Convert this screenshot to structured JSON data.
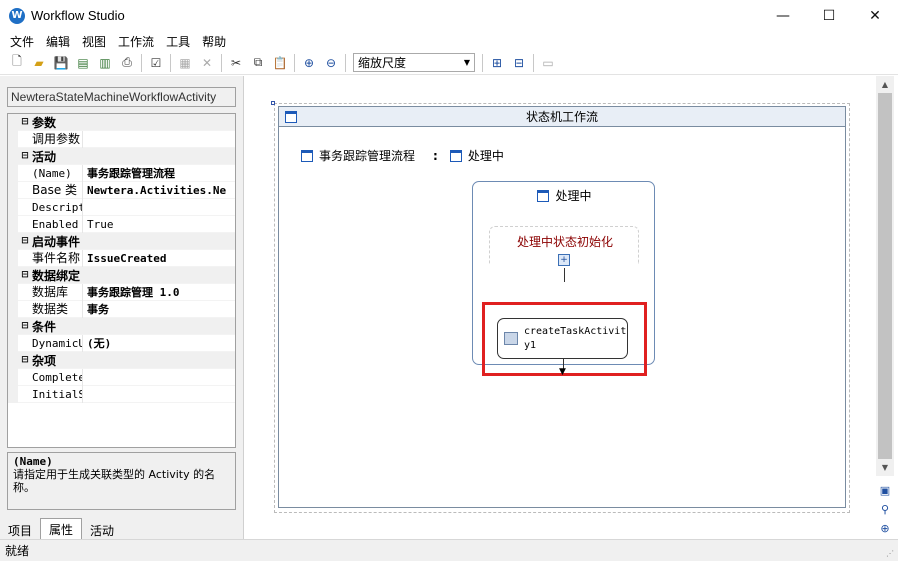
{
  "window": {
    "title": "Workflow Studio",
    "app_icon": "W",
    "minimize": "—",
    "maximize": "☐",
    "close": "✕"
  },
  "menu": [
    "文件",
    "编辑",
    "视图",
    "工作流",
    "工具",
    "帮助"
  ],
  "toolbar": {
    "zoom_label": "缩放尺度"
  },
  "properties": {
    "object_name": "NewteraStateMachineWorkflowActivity",
    "rows": [
      {
        "type": "cat",
        "label": "参数"
      },
      {
        "type": "prop",
        "name": "调用参数",
        "value": "",
        "lock": true
      },
      {
        "type": "cat",
        "label": "活动"
      },
      {
        "type": "prop",
        "name": "(Name)",
        "value": "事务跟踪管理流程",
        "bold": true
      },
      {
        "type": "prop",
        "name": "Base 类",
        "value": "Newtera.Activities.Ne",
        "bold": true
      },
      {
        "type": "prop",
        "name": "Descriptio",
        "value": ""
      },
      {
        "type": "prop",
        "name": "Enabled",
        "value": "True"
      },
      {
        "type": "cat",
        "label": "启动事件"
      },
      {
        "type": "prop",
        "name": "事件名称",
        "value": "IssueCreated",
        "bold": true
      },
      {
        "type": "cat",
        "label": "数据绑定"
      },
      {
        "type": "prop",
        "name": "数据库",
        "value": "事务跟踪管理 1.0",
        "bold": true
      },
      {
        "type": "prop",
        "name": "数据类",
        "value": "事务",
        "bold": true
      },
      {
        "type": "cat",
        "label": "条件"
      },
      {
        "type": "prop",
        "name": "DynamicUpd",
        "value": "(无)",
        "bold": true
      },
      {
        "type": "cat",
        "label": "杂项"
      },
      {
        "type": "prop",
        "name": "CompletedS",
        "value": ""
      },
      {
        "type": "prop",
        "name": "InitialSta",
        "value": ""
      }
    ],
    "description": {
      "title": "(Name)",
      "text": "请指定用于生成关联类型的 Activity 的名称。"
    },
    "tabs": [
      "项目",
      "属性",
      "活动"
    ]
  },
  "designer": {
    "state_machine_title": "状态机工作流",
    "link_workflow": "事务跟踪管理流程",
    "link_separator": ":",
    "link_state": "处理中",
    "state_title": "处理中",
    "init_title": "处理中状态初始化",
    "activity_name": "createTaskActivity1"
  },
  "status": {
    "text": "就绪"
  }
}
